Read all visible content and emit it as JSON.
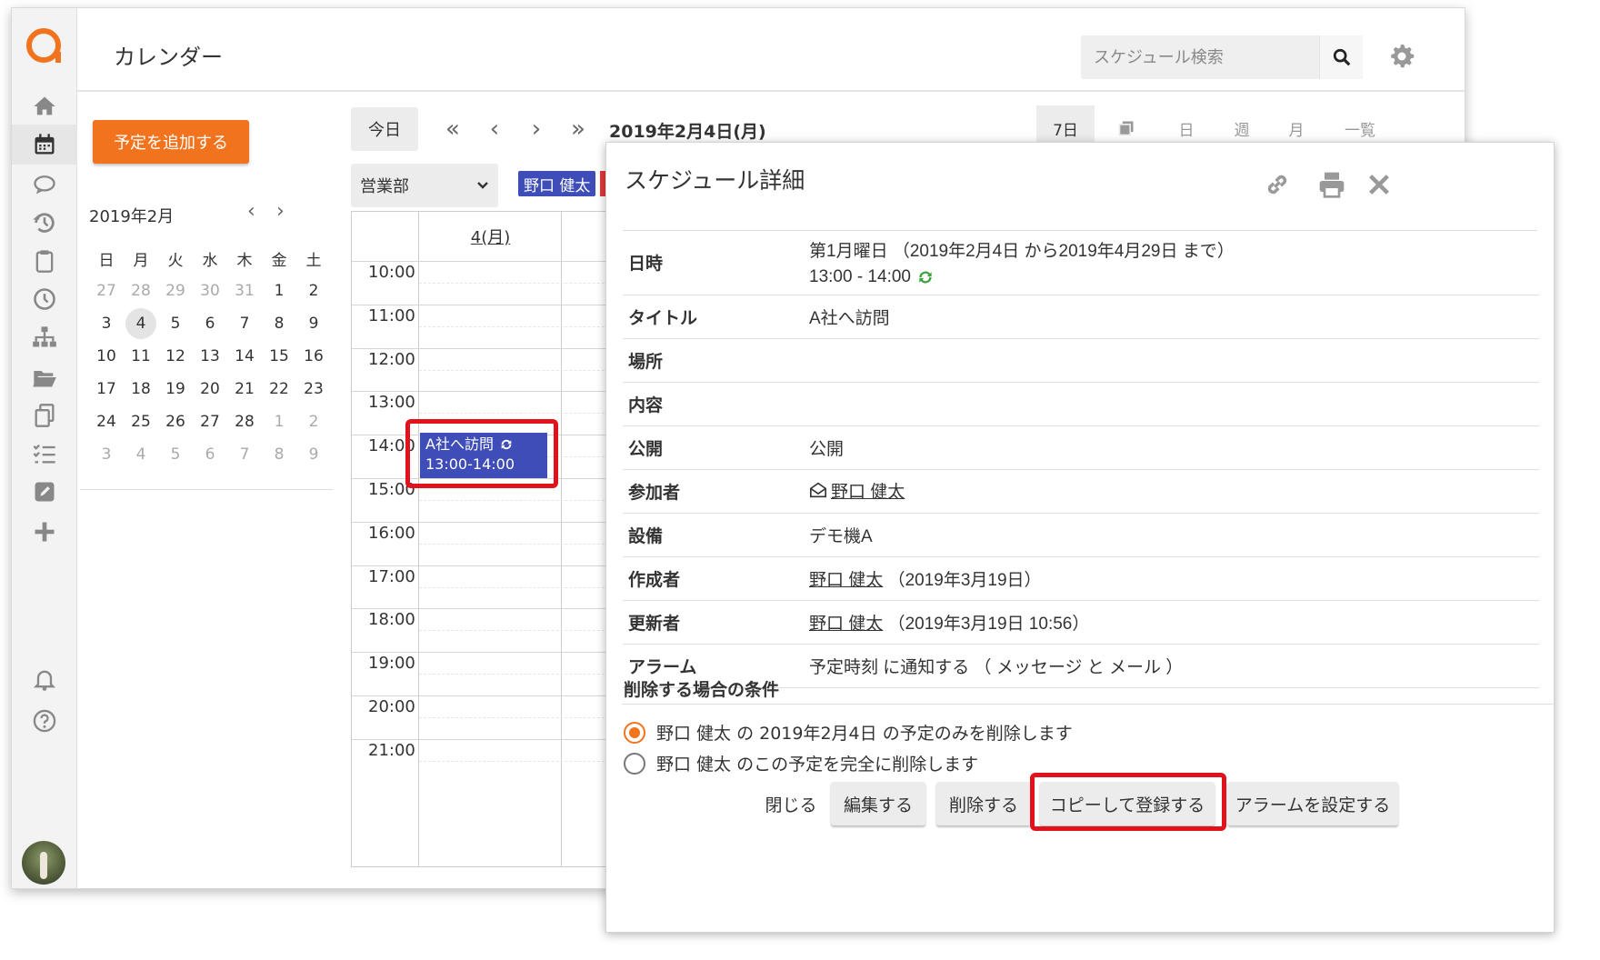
{
  "app": {
    "title": "カレンダー",
    "search_placeholder": "スケジュール検索",
    "accent": "#f2731d"
  },
  "sidebar": {
    "items": [
      "home-icon",
      "calendar-icon",
      "chat-icon",
      "history-icon",
      "clipboard-icon",
      "clock-icon",
      "org-chart-icon",
      "folder-icon",
      "copy-icon",
      "checklist-icon",
      "edit-icon",
      "plus-icon",
      "bell-icon",
      "help-icon"
    ]
  },
  "left": {
    "add_button": "予定を追加する",
    "mini_cal_title": "2019年2月",
    "prev": "‹",
    "next": "›",
    "dow": [
      "日",
      "月",
      "火",
      "水",
      "木",
      "金",
      "土"
    ],
    "weeks": [
      [
        "27",
        "28",
        "29",
        "30",
        "31",
        "1",
        "2"
      ],
      [
        "3",
        "4",
        "5",
        "6",
        "7",
        "8",
        "9"
      ],
      [
        "10",
        "11",
        "12",
        "13",
        "14",
        "15",
        "16"
      ],
      [
        "17",
        "18",
        "19",
        "20",
        "21",
        "22",
        "23"
      ],
      [
        "24",
        "25",
        "26",
        "27",
        "28",
        "1",
        "2"
      ],
      [
        "3",
        "4",
        "5",
        "6",
        "7",
        "8",
        "9"
      ]
    ]
  },
  "toolbar": {
    "today": "今日",
    "first": "«",
    "prev": "‹",
    "next": "›",
    "last": "»",
    "current_date": "2019年2月4日(月)",
    "views": [
      "7日",
      "",
      "日",
      "週",
      "月",
      "一覧"
    ],
    "department": "営業部",
    "member": "野口 健太"
  },
  "grid": {
    "day_header": "4(月)",
    "hours": [
      "10:00",
      "11:00",
      "12:00",
      "13:00",
      "14:00",
      "15:00",
      "16:00",
      "17:00",
      "18:00",
      "19:00",
      "20:00",
      "21:00"
    ],
    "event_title": "A社へ訪問",
    "event_time": "13:00-14:00"
  },
  "modal": {
    "title": "スケジュール詳細",
    "rows": [
      {
        "k": "日時",
        "v1": "第1月曜日 （2019年2月4日 から2019年4月29日 まで）",
        "v2": "13:00 - 14:00"
      },
      {
        "k": "タイトル",
        "v": "A社へ訪問"
      },
      {
        "k": "場所",
        "v": ""
      },
      {
        "k": "内容",
        "v": ""
      },
      {
        "k": "公開",
        "v": "公開"
      },
      {
        "k": "参加者",
        "v": "野口 健太"
      },
      {
        "k": "設備",
        "v": "デモ機A"
      },
      {
        "k": "作成者",
        "v_link": "野口 健太",
        "v_rest": "（2019年3月19日）"
      },
      {
        "k": "更新者",
        "v_link": "野口 健太",
        "v_rest": "（2019年3月19日 10:56）"
      },
      {
        "k": "アラーム",
        "v": "予定時刻 に通知する （ メッセージ と メール ）"
      }
    ],
    "cond_title": "削除する場合の条件",
    "radio1": "野口 健太 の 2019年2月4日 の予定のみを削除します",
    "radio2": "野口 健太 のこの予定を完全に削除します",
    "btn_close": "閉じる",
    "btn_edit": "編集する",
    "btn_delete": "削除する",
    "btn_copy": "コピーして登録する",
    "btn_alarm": "アラームを設定する"
  }
}
